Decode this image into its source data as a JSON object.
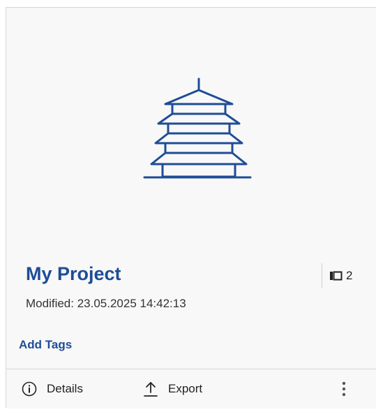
{
  "project": {
    "title": "My Project",
    "modified": "Modified: 23.05.2025 14:42:13",
    "count": "2",
    "count_icon": "layers-icon",
    "thumbnail_icon": "pagoda-icon"
  },
  "tags": {
    "add_label": "Add Tags"
  },
  "footer": {
    "details_label": "Details",
    "details_icon": "info-icon",
    "export_label": "Export",
    "export_icon": "upload-icon",
    "more_icon": "more-vertical-icon"
  },
  "colors": {
    "accent": "#1e4d96",
    "card_bg": "#f8f8f8",
    "border": "#d6d6d6"
  }
}
